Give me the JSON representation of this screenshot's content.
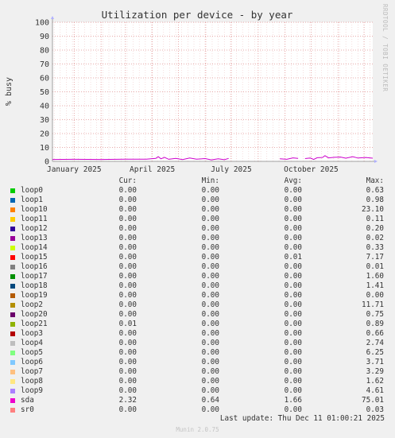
{
  "chart_data": {
    "type": "line",
    "title": "Utilization per device - by year",
    "ylabel": "% busy",
    "ylim": [
      0,
      100
    ],
    "yticks": [
      0,
      10,
      20,
      30,
      40,
      50,
      60,
      70,
      80,
      90,
      100
    ],
    "xlim": [
      "2024-12-07",
      "2025-12-11"
    ],
    "xticks": [
      {
        "date": "2025-01-01",
        "label": "January 2025"
      },
      {
        "date": "2025-04-01",
        "label": "April 2025"
      },
      {
        "date": "2025-07-01",
        "label": "July 2025"
      },
      {
        "date": "2025-10-01",
        "label": "October 2025"
      }
    ],
    "grid": true,
    "series": [
      {
        "name": "sda",
        "color": "#CC00CC",
        "segments": [
          [
            [
              "2024-12-07",
              1.4
            ],
            [
              "2025-01-01",
              1.5
            ],
            [
              "2025-02-01",
              1.4
            ],
            [
              "2025-03-01",
              1.6
            ],
            [
              "2025-03-25",
              1.6
            ],
            [
              "2025-04-05",
              2.2
            ],
            [
              "2025-04-08",
              3.4
            ],
            [
              "2025-04-11",
              1.8
            ],
            [
              "2025-04-15",
              2.9
            ],
            [
              "2025-04-20",
              1.5
            ],
            [
              "2025-04-28",
              2.1
            ],
            [
              "2025-05-06",
              1.3
            ],
            [
              "2025-05-14",
              2.4
            ],
            [
              "2025-05-22",
              1.6
            ],
            [
              "2025-06-01",
              2.0
            ],
            [
              "2025-06-08",
              1.1
            ],
            [
              "2025-06-16",
              1.9
            ],
            [
              "2025-06-23",
              1.2
            ],
            [
              "2025-06-28",
              2.1
            ]
          ],
          [
            [
              "2025-08-26",
              1.9
            ],
            [
              "2025-09-03",
              1.5
            ],
            [
              "2025-09-10",
              2.5
            ],
            [
              "2025-09-16",
              2.2
            ]
          ],
          [
            [
              "2025-09-24",
              2.0
            ],
            [
              "2025-09-30",
              2.4
            ],
            [
              "2025-10-04",
              1.4
            ],
            [
              "2025-10-08",
              2.6
            ],
            [
              "2025-10-14",
              2.8
            ],
            [
              "2025-10-17",
              4.1
            ],
            [
              "2025-10-21",
              2.5
            ],
            [
              "2025-10-28",
              2.9
            ],
            [
              "2025-11-04",
              3.1
            ],
            [
              "2025-11-10",
              2.3
            ],
            [
              "2025-11-18",
              3.4
            ],
            [
              "2025-11-24",
              2.4
            ],
            [
              "2025-12-03",
              2.8
            ],
            [
              "2025-12-11",
              2.3
            ]
          ]
        ]
      }
    ],
    "legend": {
      "headers": {
        "cur": "Cur:",
        "min": "Min:",
        "avg": "Avg:",
        "max": "Max:"
      },
      "rows": [
        {
          "name": "loop0",
          "color": "#00CC00",
          "cur": "0.00",
          "min": "0.00",
          "avg": "0.00",
          "max": "0.63"
        },
        {
          "name": "loop1",
          "color": "#0066B3",
          "cur": "0.00",
          "min": "0.00",
          "avg": "0.00",
          "max": "0.98"
        },
        {
          "name": "loop10",
          "color": "#FF8000",
          "cur": "0.00",
          "min": "0.00",
          "avg": "0.00",
          "max": "23.10"
        },
        {
          "name": "loop11",
          "color": "#FFCC00",
          "cur": "0.00",
          "min": "0.00",
          "avg": "0.00",
          "max": "0.11"
        },
        {
          "name": "loop12",
          "color": "#330099",
          "cur": "0.00",
          "min": "0.00",
          "avg": "0.00",
          "max": "0.20"
        },
        {
          "name": "loop13",
          "color": "#990099",
          "cur": "0.00",
          "min": "0.00",
          "avg": "0.00",
          "max": "0.02"
        },
        {
          "name": "loop14",
          "color": "#CCFF00",
          "cur": "0.00",
          "min": "0.00",
          "avg": "0.00",
          "max": "0.33"
        },
        {
          "name": "loop15",
          "color": "#FF0000",
          "cur": "0.00",
          "min": "0.00",
          "avg": "0.01",
          "max": "7.17"
        },
        {
          "name": "loop16",
          "color": "#808080",
          "cur": "0.00",
          "min": "0.00",
          "avg": "0.00",
          "max": "0.01"
        },
        {
          "name": "loop17",
          "color": "#008F00",
          "cur": "0.00",
          "min": "0.00",
          "avg": "0.00",
          "max": "1.60"
        },
        {
          "name": "loop18",
          "color": "#00487D",
          "cur": "0.00",
          "min": "0.00",
          "avg": "0.00",
          "max": "1.41"
        },
        {
          "name": "loop19",
          "color": "#B35A00",
          "cur": "0.00",
          "min": "0.00",
          "avg": "0.00",
          "max": "0.00"
        },
        {
          "name": "loop2",
          "color": "#B38F00",
          "cur": "0.00",
          "min": "0.00",
          "avg": "0.00",
          "max": "11.71"
        },
        {
          "name": "loop20",
          "color": "#6B006B",
          "cur": "0.00",
          "min": "0.00",
          "avg": "0.00",
          "max": "0.75"
        },
        {
          "name": "loop21",
          "color": "#8FB300",
          "cur": "0.01",
          "min": "0.00",
          "avg": "0.00",
          "max": "0.89"
        },
        {
          "name": "loop3",
          "color": "#B30000",
          "cur": "0.00",
          "min": "0.00",
          "avg": "0.00",
          "max": "0.66"
        },
        {
          "name": "loop4",
          "color": "#BEBEBE",
          "cur": "0.00",
          "min": "0.00",
          "avg": "0.00",
          "max": "2.74"
        },
        {
          "name": "loop5",
          "color": "#80FF80",
          "cur": "0.00",
          "min": "0.00",
          "avg": "0.00",
          "max": "6.25"
        },
        {
          "name": "loop6",
          "color": "#80C9FF",
          "cur": "0.00",
          "min": "0.00",
          "avg": "0.00",
          "max": "3.71"
        },
        {
          "name": "loop7",
          "color": "#FFC080",
          "cur": "0.00",
          "min": "0.00",
          "avg": "0.00",
          "max": "3.29"
        },
        {
          "name": "loop8",
          "color": "#FFE680",
          "cur": "0.00",
          "min": "0.00",
          "avg": "0.00",
          "max": "1.62"
        },
        {
          "name": "loop9",
          "color": "#AA80FF",
          "cur": "0.00",
          "min": "0.00",
          "avg": "0.00",
          "max": "4.61"
        },
        {
          "name": "sda",
          "color": "#EE00CC",
          "cur": "2.32",
          "min": "0.64",
          "avg": "1.66",
          "max": "75.01"
        },
        {
          "name": "sr0",
          "color": "#FF8080",
          "cur": "0.00",
          "min": "0.00",
          "avg": "0.00",
          "max": "0.03"
        }
      ]
    }
  },
  "footer": {
    "last_update": "Last update: Thu Dec 11 01:00:21 2025",
    "generator": "Munin 2.0.75",
    "watermark": "RRDTOOL / TOBI OETIKER"
  }
}
